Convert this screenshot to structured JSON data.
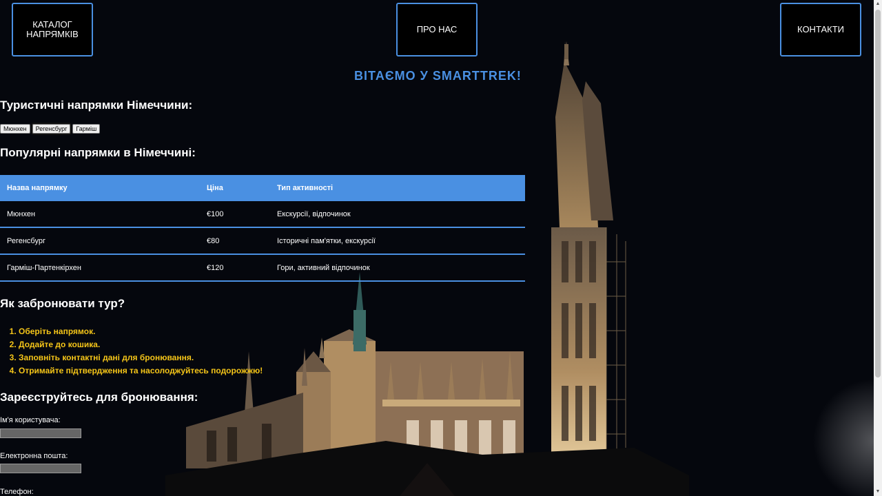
{
  "nav": {
    "catalog": "КАТАЛОГ НАПРЯМКІВ",
    "about": "ПРО НАС",
    "contacts": "КОНТАКТИ"
  },
  "welcome": "ВІТАЄМО У SMARTTREK!",
  "section_destinations": "Туристичні напрямки Німеччини:",
  "city_buttons": [
    "Мюнхен",
    "Регенсбург",
    "Гарміш"
  ],
  "section_popular": "Популярні напрямки в Німеччині:",
  "table": {
    "headers": [
      "Назва напрямку",
      "Ціна",
      "Тип активності"
    ],
    "rows": [
      [
        "Мюнхен",
        "€100",
        "Екскурсії, відпочинок"
      ],
      [
        "Регенсбург",
        "€80",
        "Історичні пам'ятки, екскурсії"
      ],
      [
        "Гарміш-Партенкірхен",
        "€120",
        "Гори, активний відпочинок"
      ]
    ]
  },
  "section_howto": "Як забронювати тур?",
  "steps": [
    "Оберіть напрямок.",
    "Додайте до кошика.",
    "Заповніть контактні дані для бронювання.",
    "Отримайте підтвердження та насолоджуйтесь подорожжю!"
  ],
  "section_register": "Зареєструйтесь для бронювання:",
  "form": {
    "username_label": "Ім'я користувача:",
    "email_label": "Електронна пошта:",
    "phone_label": "Телефон:"
  },
  "colors": {
    "accent": "#4a90e2",
    "steps": "#f5c518",
    "background": "#05070d"
  }
}
